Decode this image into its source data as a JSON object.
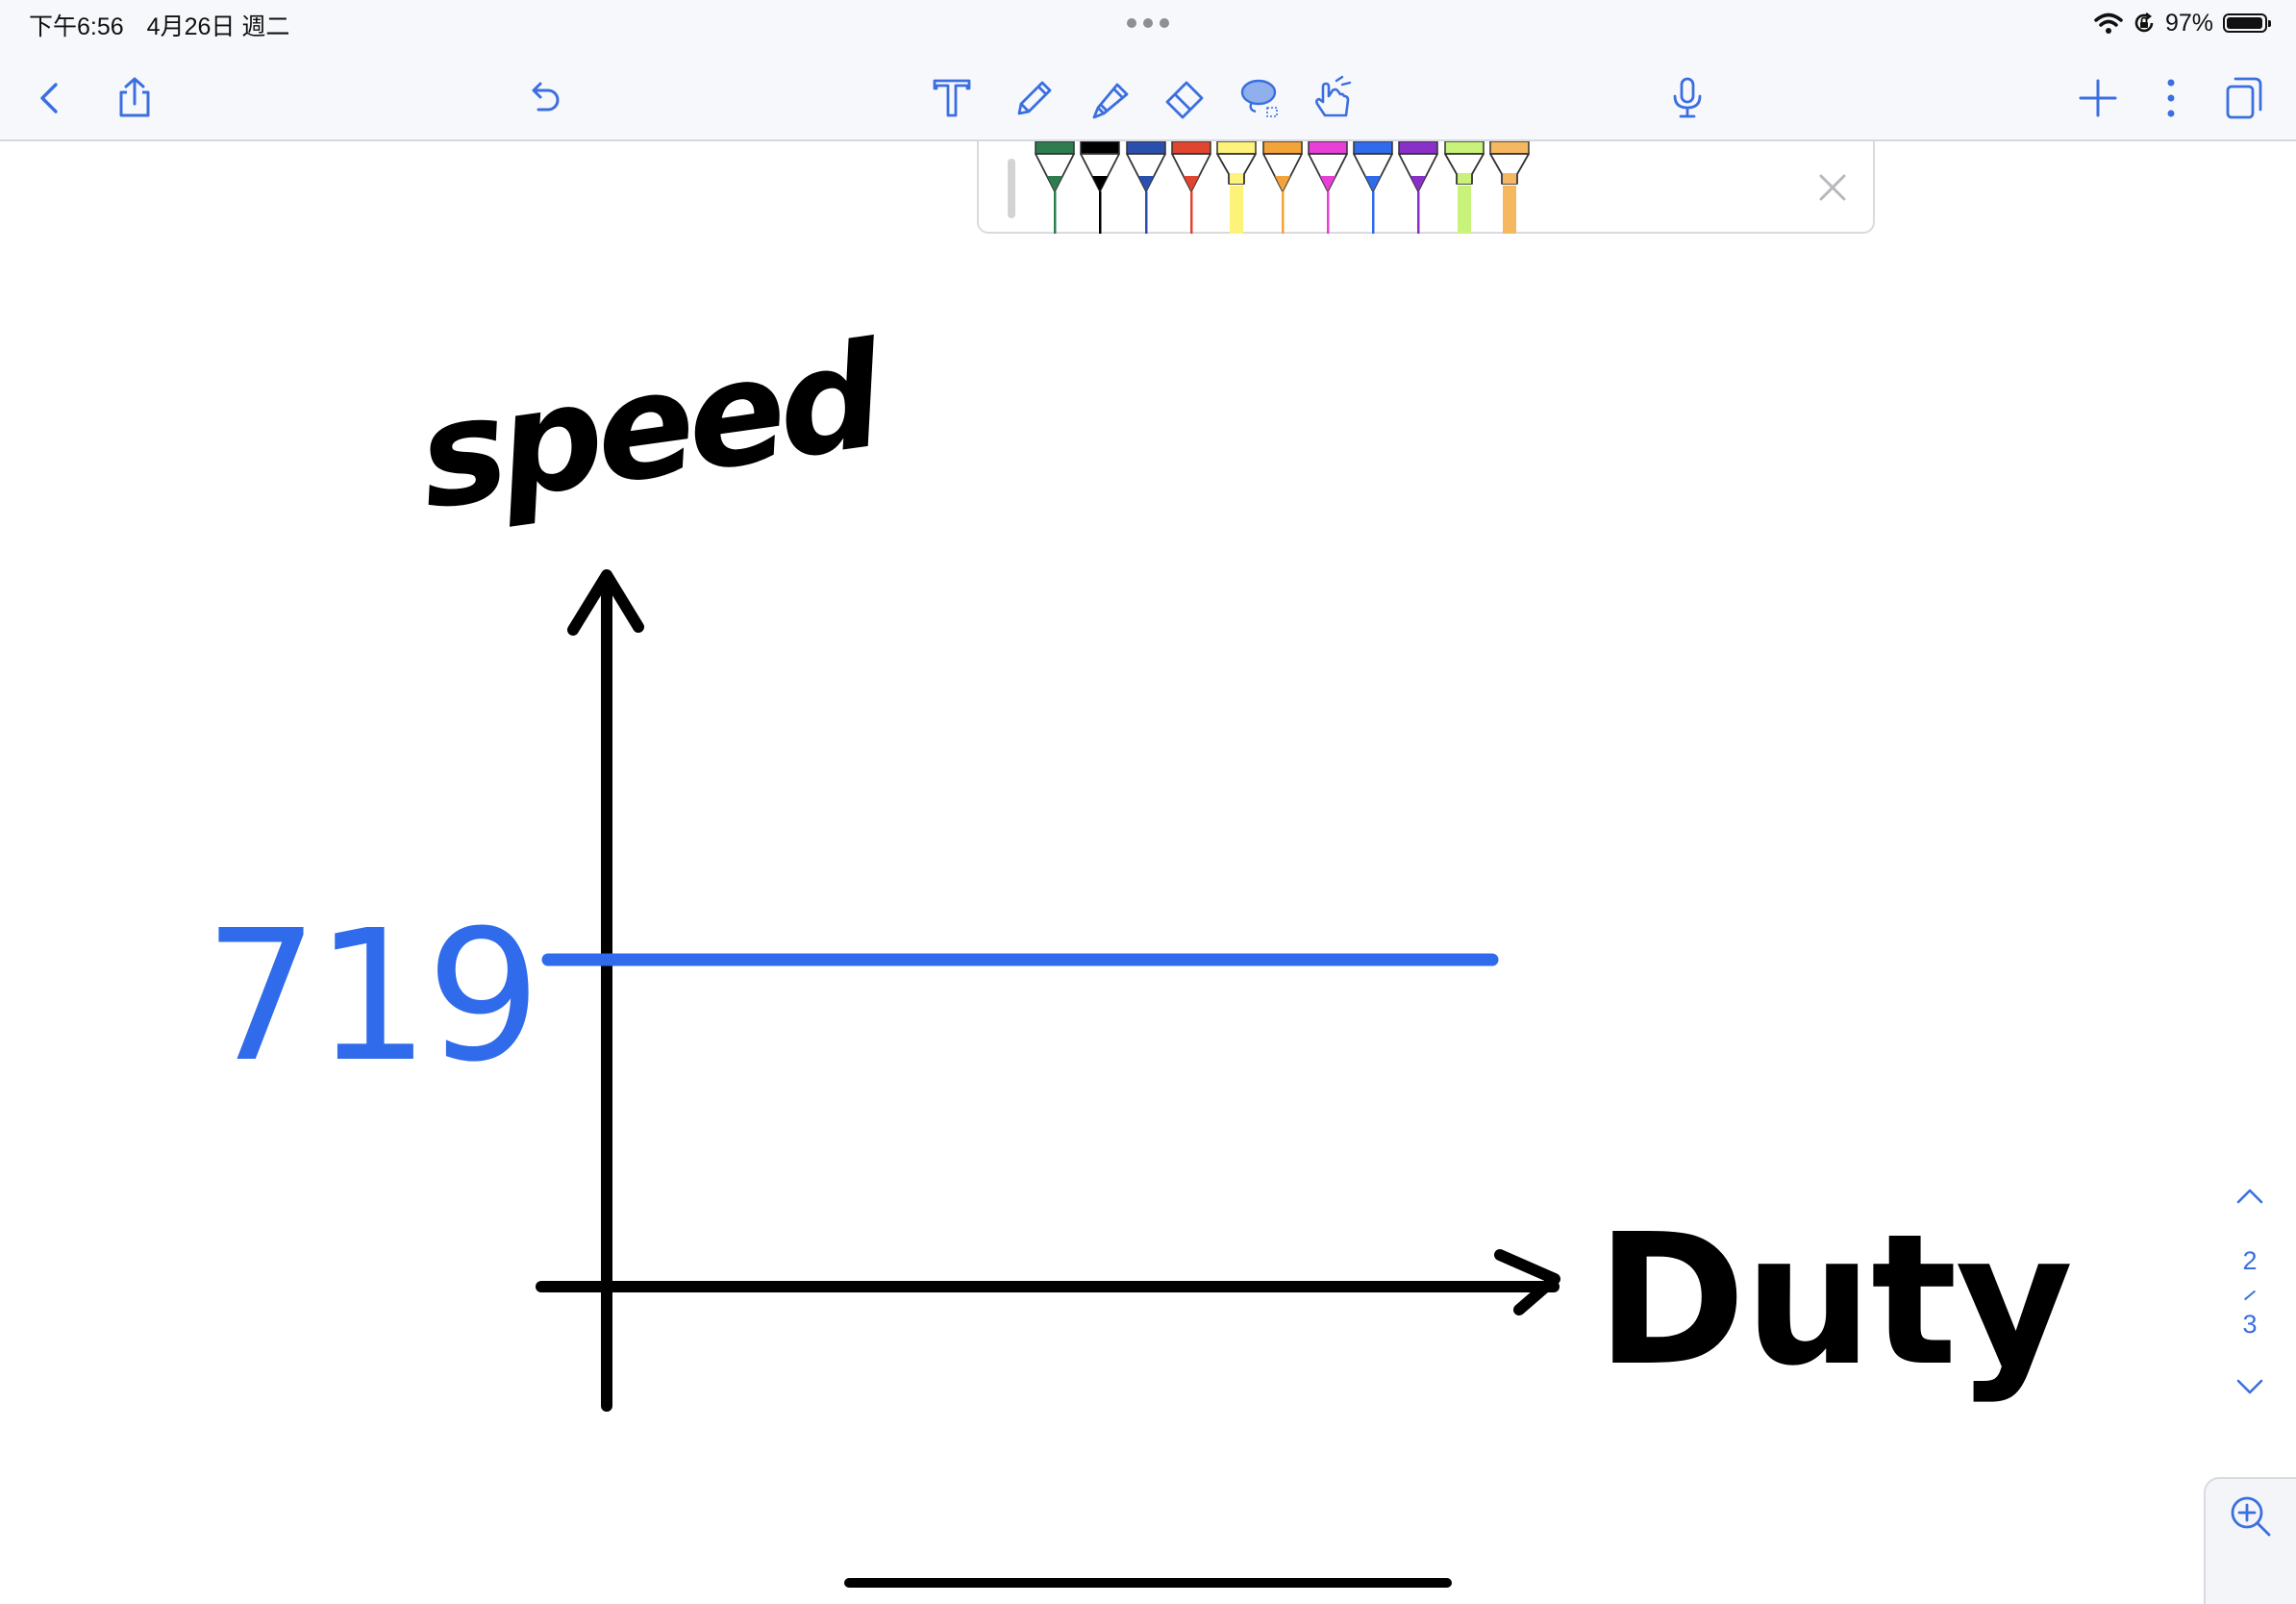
{
  "status_bar": {
    "time": "下午6:56",
    "date": "4月26日 週二",
    "battery_percent": "97%",
    "battery_level": 0.97,
    "icons": [
      "wifi-icon",
      "orientation-lock-icon",
      "battery-icon"
    ]
  },
  "toolbar": {
    "left": [
      "back-chevron-icon",
      "share-icon",
      "undo-icon"
    ],
    "tools": [
      "text-tool-icon",
      "pen-tool-icon",
      "highlighter-tool-icon",
      "eraser-tool-icon",
      "lasso-tool-icon",
      "hand-pointer-tool-icon"
    ],
    "center_right": [
      "microphone-icon"
    ],
    "right": [
      "add-icon",
      "more-vertical-icon",
      "pages-icon"
    ],
    "accent_color": "#3b6fe0"
  },
  "pen_tray": {
    "pens": [
      {
        "kind": "pen",
        "color": "#2e7d4f"
      },
      {
        "kind": "pen",
        "color": "#000000"
      },
      {
        "kind": "pen",
        "color": "#2b4fae"
      },
      {
        "kind": "pen",
        "color": "#e0462f"
      },
      {
        "kind": "highlighter",
        "color": "#fdf27a"
      },
      {
        "kind": "pen",
        "color": "#f2a33a"
      },
      {
        "kind": "pen",
        "color": "#e83fd6"
      },
      {
        "kind": "pen",
        "color": "#2f6bea"
      },
      {
        "kind": "pen",
        "color": "#8a2fc8"
      },
      {
        "kind": "highlighter",
        "color": "#c8f27a"
      },
      {
        "kind": "highlighter",
        "color": "#f5b860"
      }
    ],
    "close_icon": "close-icon"
  },
  "canvas": {
    "y_axis_label": "speed",
    "x_axis_label": "Duty",
    "value_label": "719",
    "ink_color": "#000000",
    "line_color": "#2f6bea"
  },
  "page_nav": {
    "current": "2",
    "total": "3"
  }
}
